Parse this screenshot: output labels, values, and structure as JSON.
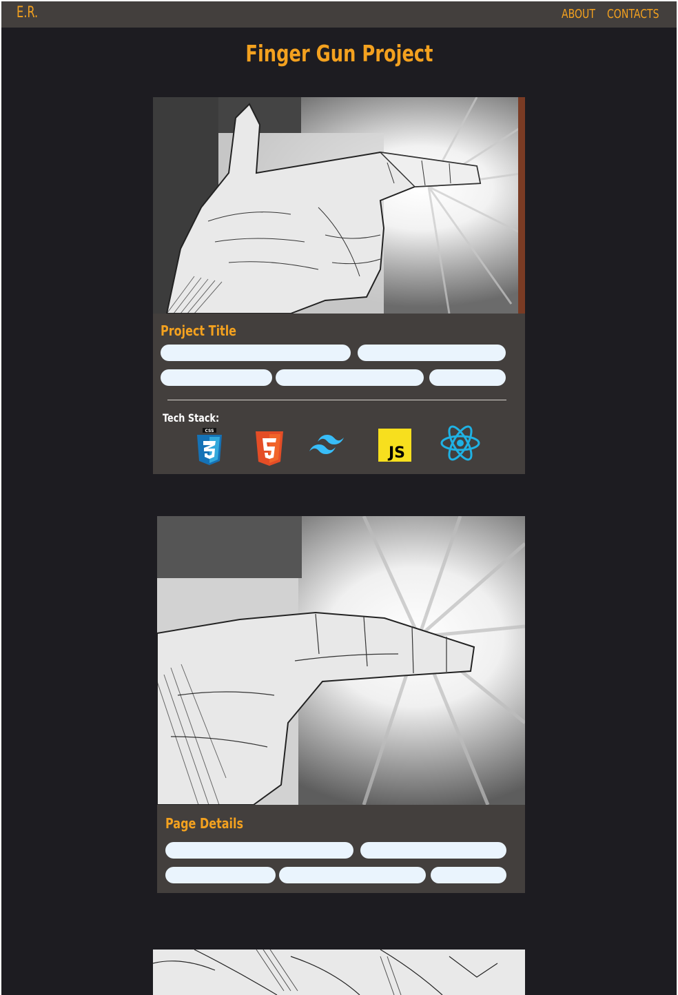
{
  "nav": {
    "brand": "E.R.",
    "links": [
      {
        "label": "ABOUT"
      },
      {
        "label": "CONTACTS"
      }
    ]
  },
  "page": {
    "title": "Finger Gun Project"
  },
  "cards": [
    {
      "heading": "Project Title",
      "image_alt": "Ink drawing of a hand making a finger gun",
      "tech_stack_label": "Tech Stack:",
      "tech_icons": [
        "css3-icon",
        "html5-icon",
        "tailwind-icon",
        "javascript-icon",
        "react-icon"
      ],
      "css_badge_text": "CSS",
      "js_badge_text": "JS"
    },
    {
      "heading": "Page Details",
      "image_alt": "Close-up ink drawing of finger gun with burst"
    }
  ],
  "colors": {
    "background": "#1d1c21",
    "navbar": "#433f3d",
    "accent": "#f3a11f",
    "card": "#433f3d",
    "pill": "#eaf4fd"
  }
}
